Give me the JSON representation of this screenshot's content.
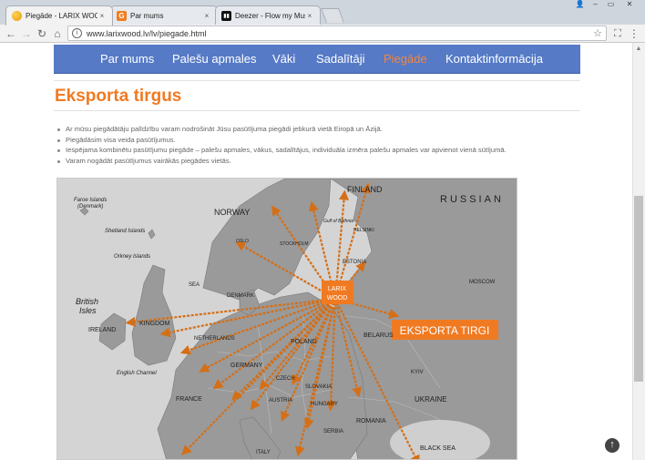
{
  "browser": {
    "tabs": [
      {
        "title": "Piegāde - LARIX WOOD",
        "icon": "globe-favicon"
      },
      {
        "title": "Par mums",
        "icon": "g-favicon"
      },
      {
        "title": "Deezer - Flow my Music",
        "icon": "deezer-favicon"
      }
    ],
    "url": "www.larixwood.lv/lv/piegade.html",
    "close_glyph": "×"
  },
  "nav": {
    "items": [
      "Par mums",
      "Palešu apmales",
      "Vāki",
      "Sadalītāji",
      "Piegāde",
      "Kontaktinformācija"
    ],
    "active_index": 4
  },
  "page": {
    "title": "Eksporta tirgus",
    "bullets": [
      "Ar mūsu piegādātāju palīdzību varam nodrošināt Jūsu pasūtījuma piegādi jebkurā vietā Eiropā un Āzijā.",
      "Piegādāsim visa veida pasūtījumus.",
      "Iespējama kombinētu pasūtījumu piegāde – palešu apmales, vākus, sadalītājus, individuāla izmēra palešu apmales var apvienot vienā sūtījumā.",
      "Varam nogādāt pasūtījumus vairākās piegādes vietās."
    ]
  },
  "map": {
    "logo_line1": "LARIX",
    "logo_line2": "WOOD",
    "badge": "EKSPORTA TIRGI",
    "labels": {
      "finland": "FINLAND",
      "russian": "RUSSIAN",
      "norway": "NORWAY",
      "faroe": "Faroe Islands",
      "faroe_sub": "(Denmark)",
      "shetland": "Shetland Islands",
      "orkney": "Orkney Islands",
      "british": "British",
      "isles": "Isles",
      "ireland": "IRELAND",
      "kingdom": "KINGDOM",
      "estonia": "ESTONIA",
      "helsinki": "HELSINKI",
      "stockholm": "STOCKHOLM",
      "oslo": "OSLO",
      "sea": "SEA",
      "denmark": "DENMARK",
      "netherlands": "NETHERLANDS",
      "germany": "GERMANY",
      "poland": "POLAND",
      "france": "FRANCE",
      "czech": "CZECH",
      "austria": "AUSTRIA",
      "slovakia": "SLOVAKIA",
      "hungary": "HUNGARY",
      "belarus": "BELARUS",
      "ukraine": "UKRAINE",
      "romania": "ROMANIA",
      "serbia": "SERBIA",
      "black_sea": "BLACK SEA",
      "italy": "ITALY",
      "english_channel": "English Channel",
      "moscow": "MOSCOW",
      "kyiv": "KYIV",
      "gulf": "Gulf of Bothnia"
    }
  },
  "colors": {
    "nav_bg": "#567ac6",
    "accent": "#f07a22",
    "arrow": "#d56f16"
  }
}
